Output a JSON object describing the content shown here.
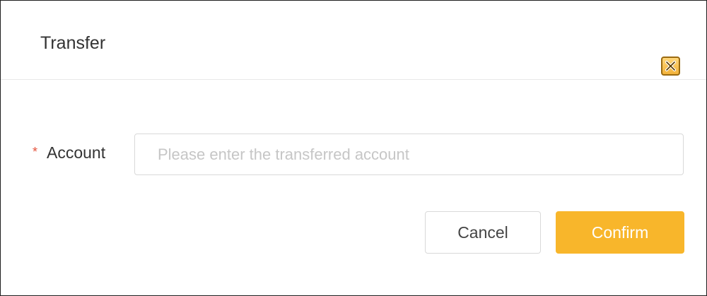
{
  "dialog": {
    "title": "Transfer",
    "close_icon": "close-icon",
    "accent_color": "#f8b62b"
  },
  "form": {
    "account": {
      "required_mark": "*",
      "label": "Account",
      "value": "",
      "placeholder": "Please enter the transferred account"
    }
  },
  "actions": {
    "cancel_label": "Cancel",
    "confirm_label": "Confirm"
  }
}
